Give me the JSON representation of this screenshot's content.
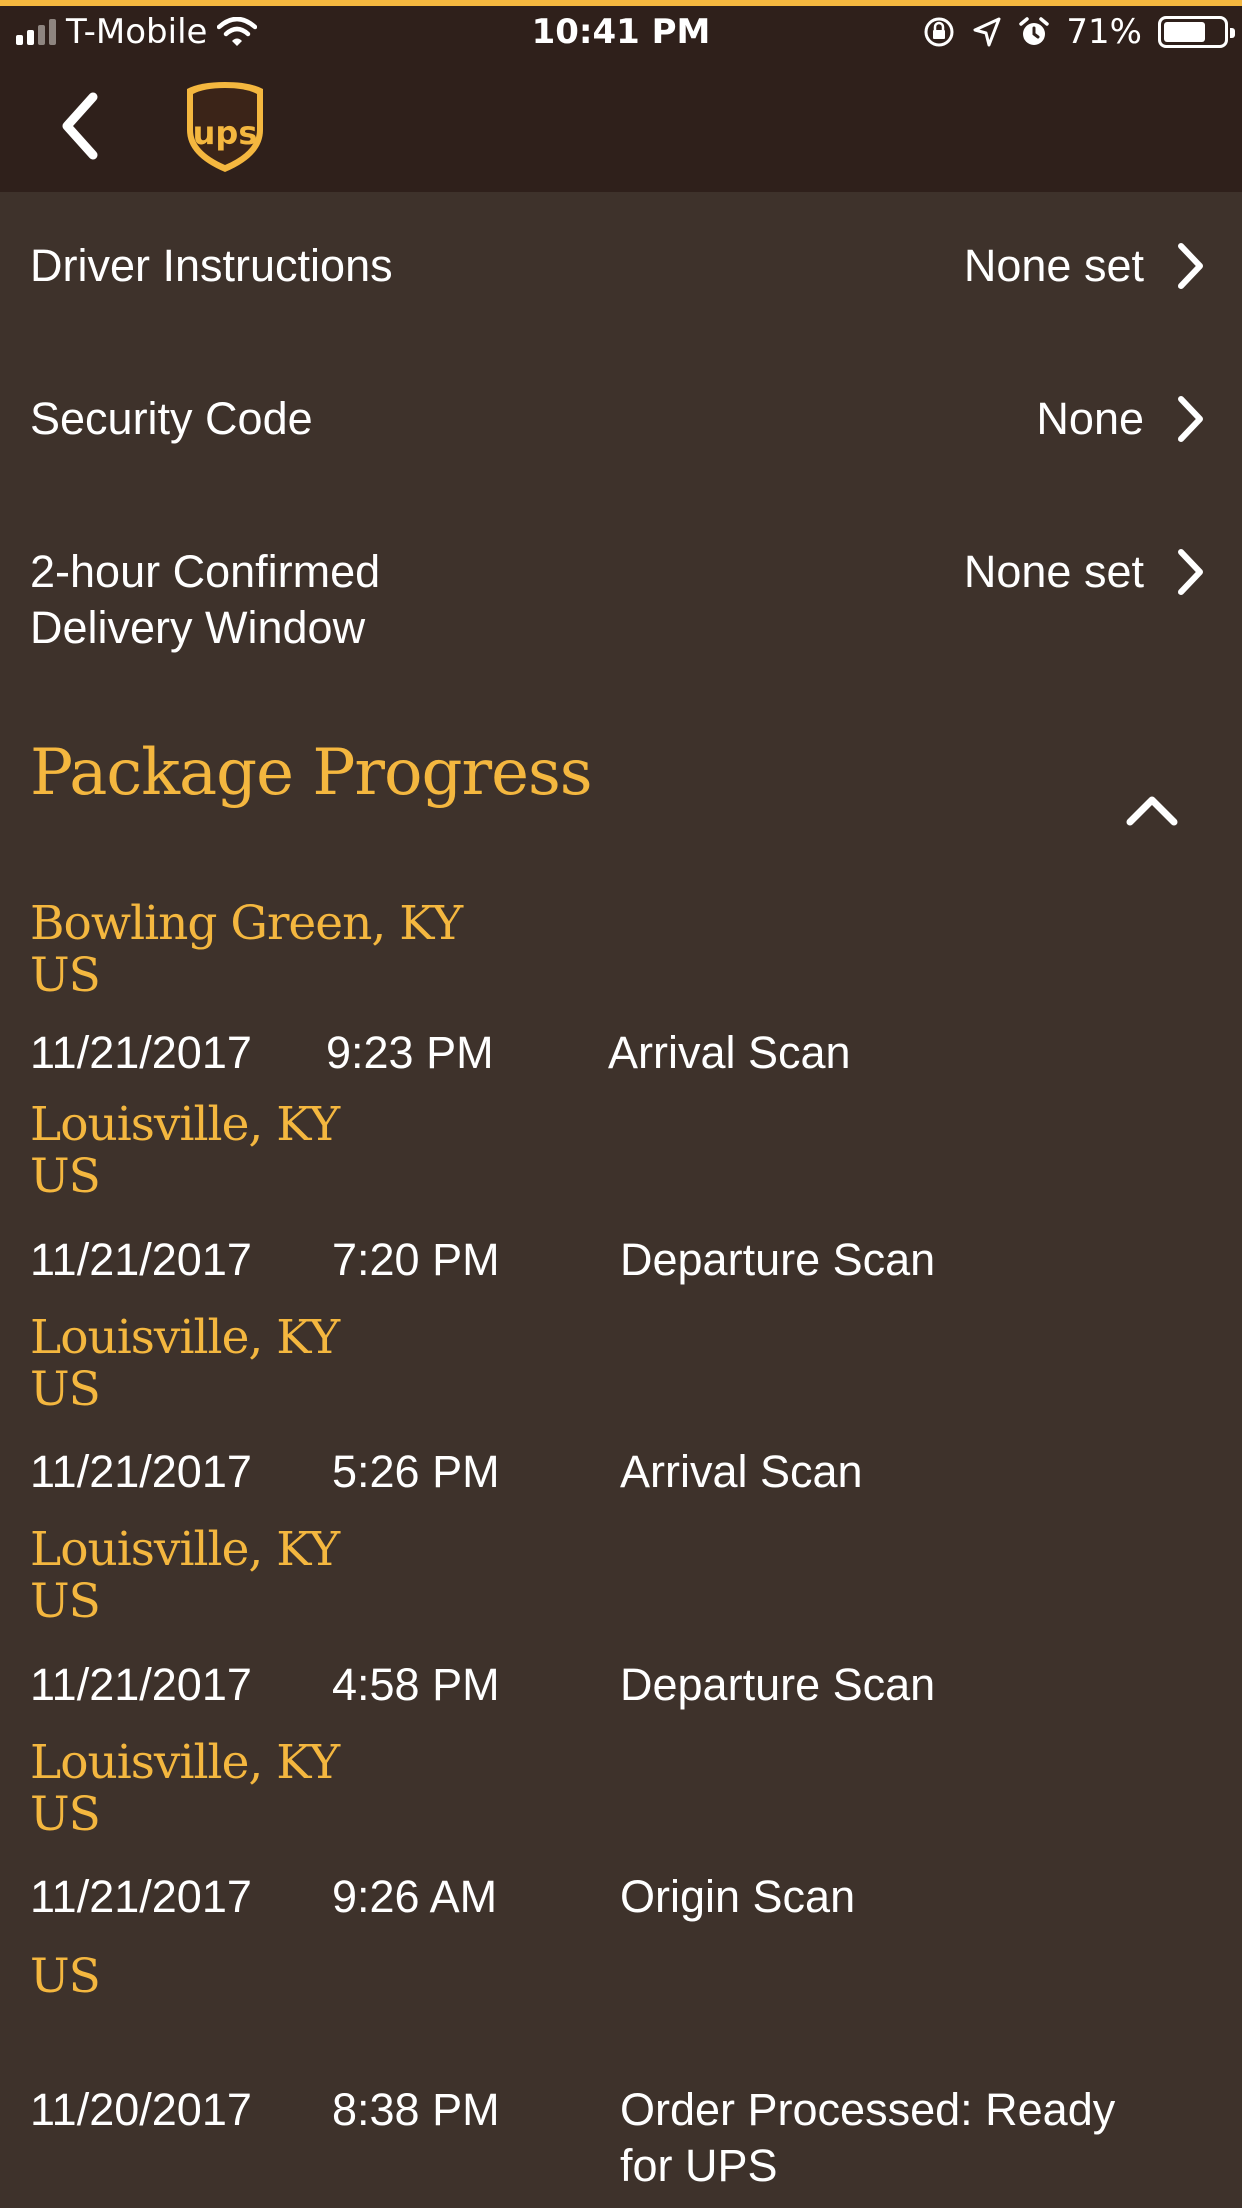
{
  "status_bar": {
    "carrier": "T-Mobile",
    "time": "10:41 PM",
    "battery": "71%",
    "battery_level": 0.71
  },
  "colors": {
    "background": "#3e322b",
    "header": "#2f201b",
    "accent": "#f4b73f"
  },
  "nav": {
    "back_icon": "chevron-left-icon",
    "logo_text": "ups"
  },
  "settings": [
    {
      "label": "Driver Instructions",
      "value": "None set"
    },
    {
      "label": "Security Code",
      "value": "None"
    },
    {
      "label": "2-hour Confirmed Delivery Window",
      "value": "None set"
    }
  ],
  "progress": {
    "title": "Package Progress",
    "collapse_icon": "chevron-up-icon",
    "entries": [
      {
        "location": "Bowling Green, KY",
        "country": "US",
        "date": "11/21/2017",
        "time": "9:23 PM",
        "activity": "Arrival Scan"
      },
      {
        "location": "Louisville, KY",
        "country": "US",
        "date": "11/21/2017",
        "time": "7:20 PM",
        "activity": "Departure Scan"
      },
      {
        "location": "Louisville, KY",
        "country": "US",
        "date": "11/21/2017",
        "time": "5:26 PM",
        "activity": "Arrival Scan"
      },
      {
        "location": "Louisville, KY",
        "country": "US",
        "date": "11/21/2017",
        "time": "4:58 PM",
        "activity": "Departure Scan"
      },
      {
        "location": "Louisville, KY",
        "country": "US",
        "date": "11/21/2017",
        "time": "9:26 AM",
        "activity": "Origin Scan"
      },
      {
        "location": "",
        "country": "US",
        "date": "11/20/2017",
        "time": "8:38 PM",
        "activity": "Order Processed: Ready for UPS"
      }
    ]
  }
}
